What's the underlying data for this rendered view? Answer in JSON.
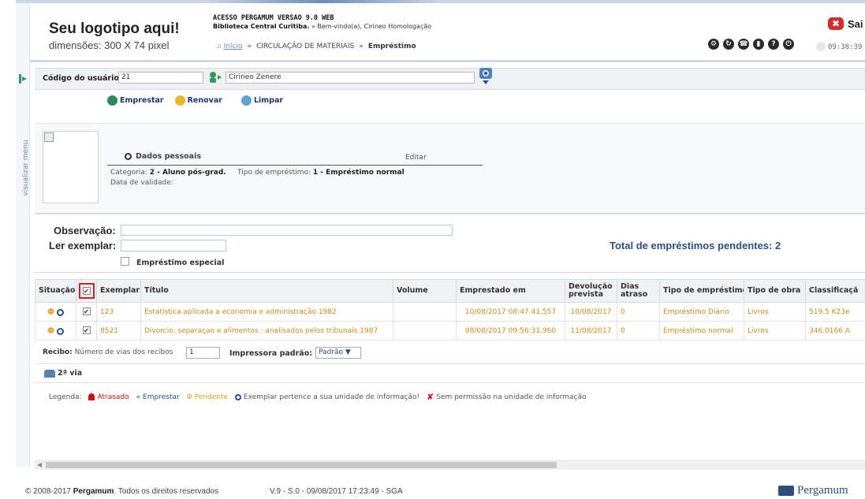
{
  "header": {
    "logo_title": "Seu logotipo aqui!",
    "logo_subtitle": "dimensões: 300 X 74 pixel",
    "system_title": "ACESSO PERGAMUM VERSAO 9.0 WEB",
    "library_name": "Biblioteca Central Curitiba.",
    "welcome": " » Bem-vindo(a), Cirineo Homologação",
    "breadcrumb": {
      "home": "Início",
      "section": "CIRCULAÇÃO DE MATERIAIS",
      "current": "Empréstimo"
    },
    "clock": "09:38:39",
    "exit_label": "Sai"
  },
  "side_menu": {
    "label": "visualizar menu"
  },
  "user": {
    "code_label": "Código do usuário:",
    "code_value": "21",
    "name_value": "Cirineo Zenere"
  },
  "actions": {
    "emprestar": "Emprestar",
    "renovar": "Renovar",
    "limpar": "Limpar"
  },
  "card": {
    "dados_pessoais": "Dados pessoais",
    "editar": "Editar",
    "categoria_label": "Categoria:",
    "categoria_value": "2 - Aluno pós-grad.",
    "tipo_emprestimo_label": "Tipo de empréstimo:",
    "tipo_emprestimo_value": "1 - Empréstimo normal",
    "data_validade_label": "Data de validade:"
  },
  "form": {
    "observacao_label": "Observação:",
    "ler_exemplar_label": "Ler exemplar:",
    "emprestimo_especial_label": "Empréstimo especial",
    "total_pendentes": "Total de empréstimos pendentes: 2"
  },
  "table": {
    "headers": {
      "situacao": "Situação",
      "exemplar": "Exemplar",
      "titulo": "Título",
      "volume": "Volume",
      "emprestado_em": "Emprestado em",
      "devolucao_1": "Devolução",
      "devolucao_2": "prevista",
      "dias_1": "Dias",
      "dias_2": "atraso",
      "tipo_emprestimo": "Tipo de empréstimo",
      "tipo_obra": "Tipo de obra",
      "classificacao": "Classificaçã"
    },
    "rows": [
      {
        "exemplar": "123",
        "titulo": "Estatística aplicada a economia e administração 1982",
        "volume": "",
        "emprestado_em": "10/08/2017 08:47:41.557",
        "devolucao": "10/08/2017",
        "dias": "0",
        "tipo_emprestimo": "Empréstimo Diário",
        "tipo_obra": "Livros",
        "classificacao": "519.5 K23e"
      },
      {
        "exemplar": "8521",
        "titulo": "Divorcio, separaçao e alimentos : analisados pelos tribunais 1987",
        "volume": "",
        "emprestado_em": "08/08/2017 09:56:31.960",
        "devolucao": "11/08/2017",
        "dias": "0",
        "tipo_emprestimo": "Empréstimo normal",
        "tipo_obra": "Livros",
        "classificacao": "346.0166 A"
      }
    ]
  },
  "receipt": {
    "recibo_label": "Recibo:",
    "vias_label": "Número de vias dos recibos",
    "vias_value": "1",
    "impressora_label": "Impressora padrão:",
    "impressora_value": "Padrão ▼",
    "segunda_via": "2ª via"
  },
  "legend": {
    "label": "Legenda:",
    "atrasado": "Atrasado",
    "emprestar": "Emprestar",
    "pendente": "Pendente",
    "exemplar_unidade": "Exemplar pertence a sua unidade de informação!",
    "sem_permissao": "Sem permissão na unidade de informação"
  },
  "footer": {
    "copyright_pre": "© 2008-2017 ",
    "brand": "Pergamum",
    "copyright_post": ". Todos os direitos reservados",
    "version": "V.9 - S.0 - 09/08/2017 17:23:49 - SGA",
    "logo_text": "Pergamum"
  },
  "colors": {
    "accent_blue": "#2a4f86",
    "row_orange": "#d08a1a",
    "highlight_red": "#d11f1f"
  }
}
